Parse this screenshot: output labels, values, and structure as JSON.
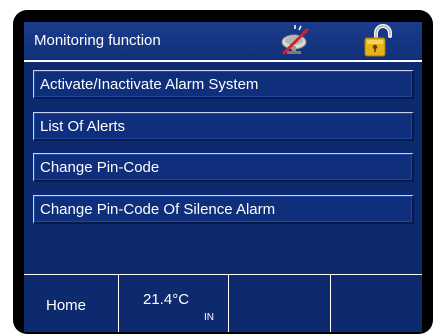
{
  "header": {
    "title": "Monitoring function",
    "status_icon": "satellite-dish-crossed-icon",
    "lock_icon": "unlocked-padlock-icon"
  },
  "menu": {
    "items": [
      {
        "label": "Activate/Inactivate Alarm System"
      },
      {
        "label": "List Of Alerts"
      },
      {
        "label": "Change Pin-Code"
      },
      {
        "label": "Change Pin-Code Of Silence Alarm"
      }
    ]
  },
  "footer": {
    "home_label": "Home",
    "temperature": "21.4°C",
    "temperature_location": "IN"
  },
  "colors": {
    "screen_background": "#0d2a6e",
    "button_background": "#0f2f7c",
    "text": "#ffffff",
    "lock_gold": "#e8b318"
  }
}
